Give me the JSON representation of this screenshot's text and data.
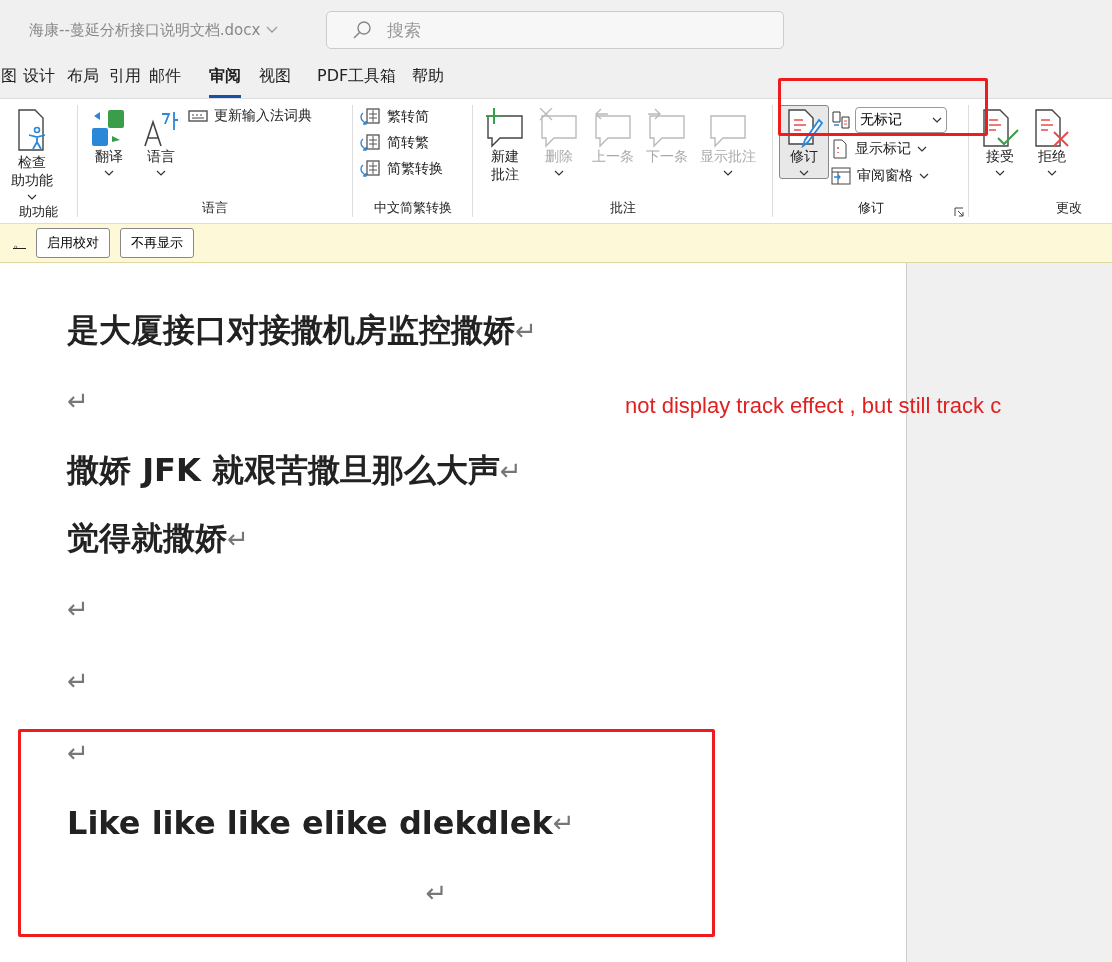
{
  "title_bar": {
    "document_name": "海康--蔓延分析接口说明文档.docx",
    "search_placeholder": "搜索"
  },
  "tabs": [
    {
      "label": "图",
      "selected": false
    },
    {
      "label": "设计",
      "selected": false
    },
    {
      "label": "布局",
      "selected": false
    },
    {
      "label": "引用",
      "selected": false
    },
    {
      "label": "邮件",
      "selected": false
    },
    {
      "label": "审阅",
      "selected": true
    },
    {
      "label": "视图",
      "selected": false
    },
    {
      "label": "PDF工具箱",
      "selected": false
    },
    {
      "label": "帮助",
      "selected": false
    }
  ],
  "ribbon_groups": [
    {
      "label": "助功能",
      "items": [
        {
          "kind": "large",
          "lines": [
            "检查",
            "助功能"
          ],
          "caret": true,
          "disabled": false,
          "selected": false
        }
      ]
    },
    {
      "label": "语言",
      "items": [
        {
          "kind": "large",
          "lines": [
            "翻译"
          ],
          "caret": true,
          "disabled": false,
          "selected": false
        },
        {
          "kind": "large",
          "lines": [
            "语言"
          ],
          "caret": true,
          "disabled": false,
          "selected": false
        },
        {
          "kind": "small",
          "label": "更新输入法词典"
        }
      ]
    },
    {
      "label": "中文简繁转换",
      "items": [
        {
          "kind": "small",
          "label": "繁转简"
        },
        {
          "kind": "small",
          "label": "简转繁"
        },
        {
          "kind": "small",
          "label": "简繁转换"
        }
      ]
    },
    {
      "label": "批注",
      "items": [
        {
          "kind": "large",
          "lines": [
            "新建",
            "批注"
          ],
          "disabled": false,
          "selected": false
        },
        {
          "kind": "large",
          "lines": [
            "删除"
          ],
          "caret": true,
          "disabled": true,
          "selected": false
        },
        {
          "kind": "large",
          "lines": [
            "上一条"
          ],
          "disabled": true,
          "selected": false
        },
        {
          "kind": "large",
          "lines": [
            "下一条"
          ],
          "disabled": true,
          "selected": false
        },
        {
          "kind": "large",
          "lines": [
            "显示批注"
          ],
          "caret": true,
          "disabled": true,
          "selected": false
        }
      ]
    },
    {
      "label": "修订",
      "items": [
        {
          "kind": "large",
          "lines": [
            "修订"
          ],
          "caret": true,
          "disabled": false,
          "selected": true
        },
        {
          "kind": "dropdown",
          "value": "无标记"
        },
        {
          "kind": "small",
          "label": "显示标记",
          "caret": true
        },
        {
          "kind": "small",
          "label": "审阅窗格",
          "caret": true
        }
      ]
    },
    {
      "label": "更改",
      "items": [
        {
          "kind": "large",
          "lines": [
            "接受"
          ],
          "caret": true,
          "disabled": false,
          "selected": false
        },
        {
          "kind": "large",
          "lines": [
            "拒绝"
          ],
          "caret": true,
          "disabled": false,
          "selected": false
        }
      ]
    }
  ],
  "info_bar": {
    "link": "。",
    "buttons": [
      "启用校对",
      "不再显示"
    ]
  },
  "document": {
    "paragraphs": [
      {
        "text": "是大厦接口对接撒机房监控撒娇",
        "mark": "↵",
        "centered": false
      },
      {
        "mark": "↵",
        "centered": false
      },
      {
        "text": "撒娇 JFK 就艰苦撒旦那么大声",
        "mark": "↵",
        "centered": false
      },
      {
        "text": "觉得就撒娇",
        "mark": "↵",
        "centered": false
      },
      {
        "mark": "↵",
        "centered": false
      },
      {
        "mark": "↵",
        "centered": false
      },
      {
        "mark": "↵",
        "centered": false
      },
      {
        "text": "Like like like elike dlekdlek ",
        "mark": "↵",
        "centered": false
      },
      {
        "mark": "↵",
        "centered": true
      }
    ]
  },
  "annotation": {
    "note": "not display track effect , but still track c"
  }
}
